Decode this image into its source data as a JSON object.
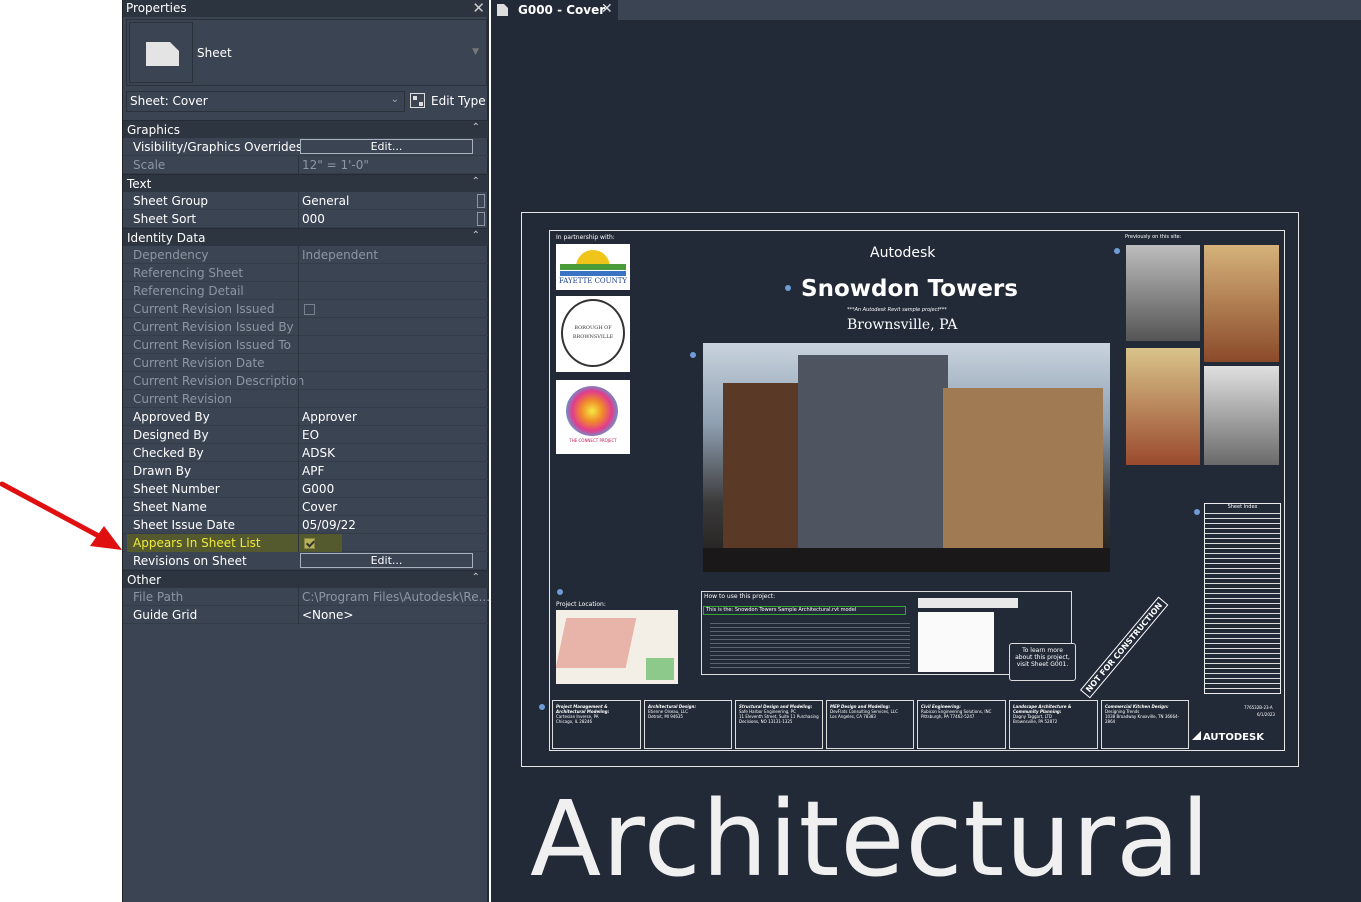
{
  "panel": {
    "title": "Properties",
    "type_name": "Sheet",
    "instance_selector": "Sheet: Cover",
    "edit_type_label": "Edit Type",
    "groups": {
      "graphics": "Graphics",
      "text": "Text",
      "identity": "Identity Data",
      "other": "Other"
    },
    "rows": {
      "vis_overrides": {
        "label": "Visibility/Graphics Overrides",
        "button": "Edit..."
      },
      "scale": {
        "label": "Scale",
        "value": "12\" = 1'-0\""
      },
      "sheet_group": {
        "label": "Sheet Group",
        "value": "General"
      },
      "sheet_sort": {
        "label": "Sheet Sort",
        "value": "000"
      },
      "dependency": {
        "label": "Dependency",
        "value": "Independent"
      },
      "referencing_sheet": {
        "label": "Referencing Sheet",
        "value": ""
      },
      "referencing_detail": {
        "label": "Referencing Detail",
        "value": ""
      },
      "cur_rev_issued": {
        "label": "Current Revision Issued",
        "checked": false
      },
      "cur_rev_issued_by": {
        "label": "Current Revision Issued By",
        "value": ""
      },
      "cur_rev_issued_to": {
        "label": "Current Revision Issued To",
        "value": ""
      },
      "cur_rev_date": {
        "label": "Current Revision Date",
        "value": ""
      },
      "cur_rev_desc": {
        "label": "Current Revision Description",
        "value": ""
      },
      "cur_rev": {
        "label": "Current Revision",
        "value": ""
      },
      "approved_by": {
        "label": "Approved By",
        "value": "Approver"
      },
      "designed_by": {
        "label": "Designed By",
        "value": "EO"
      },
      "checked_by": {
        "label": "Checked By",
        "value": "ADSK"
      },
      "drawn_by": {
        "label": "Drawn By",
        "value": "APF"
      },
      "sheet_number": {
        "label": "Sheet Number",
        "value": "G000"
      },
      "sheet_name": {
        "label": "Sheet Name",
        "value": "Cover"
      },
      "sheet_issue_date": {
        "label": "Sheet Issue Date",
        "value": "05/09/22"
      },
      "appears_in_list": {
        "label": "Appears In Sheet List",
        "checked": true
      },
      "revisions_on_sheet": {
        "label": "Revisions on Sheet",
        "button": "Edit..."
      },
      "file_path": {
        "label": "File Path",
        "value": "C:\\Program Files\\Autodesk\\Re..."
      },
      "guide_grid": {
        "label": "Guide Grid",
        "value": "<None>"
      }
    }
  },
  "view": {
    "tab_label": "G000 - Cover",
    "sheet": {
      "partnership": "In partnership with:",
      "company": "Autodesk",
      "project": "Snowdon Towers",
      "subtitle": "***An Autodesk Revit sample project***",
      "location": "Brownsville, PA",
      "previously": "Previously on this site:",
      "project_location": "Project Location:",
      "how_to": "How to use this project:",
      "this_is": "This is the: Snowdon Towers Sample Architectural.rvt model",
      "learn_more": "To learn more about this project, visit Sheet G001.",
      "stamp": "NOT FOR CONSTRUCTION",
      "sheet_index": "Sheet Index",
      "logo1": "FAYETTE COUNTY",
      "logo2": "BOROUGH OF BROWNSVILLE",
      "logo3": "THE CONNECT PROJECT",
      "project_number": "776532B-23-A",
      "date": "6/1/2023",
      "brand": "AUTODESK",
      "titleblock": [
        {
          "role": "Project Management & Architectural Modeling:",
          "name": "Cartesian Inverse, PA",
          "addr": "Chicago, IL 28246"
        },
        {
          "role": "Architectural Design:",
          "name": "Etienne Oiseau, LLC",
          "addr": "Detroit, MI 94635"
        },
        {
          "role": "Structural Design and Modeling:",
          "name": "Safe Harbor Engineering, PC",
          "addr": "11 Eleventh Street, Suite 11 Purchasing Decisions, NO 13131-1325"
        },
        {
          "role": "MEP Design and Modeling:",
          "name": "DevFlats Consulting Services, LLC",
          "addr": "Los Angeles, CA 78383"
        },
        {
          "role": "Civil Engineering:",
          "name": "Rubicon Engineering Solutions, INC",
          "addr": "Pittsburgh, PA 77462-5247"
        },
        {
          "role": "Landscape Architecture & Community Planning:",
          "name": "Dagny Taggart, LTD",
          "addr": "Brownsville, PA 52872"
        },
        {
          "role": "Commercial Kitchen Design:",
          "name": "Designing Trends",
          "addr": "1038 Broadway Knoxville, TN 36664-2864"
        }
      ]
    },
    "caption": "Architectural"
  },
  "colors": {
    "panel_bg": "#3b4453",
    "view_bg": "#222a37",
    "highlight_text": "#f0e83c",
    "arrow": "#e01010"
  }
}
